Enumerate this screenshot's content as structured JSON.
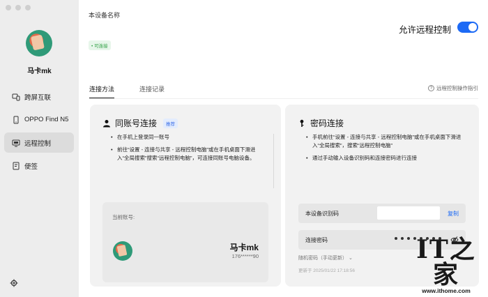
{
  "sidebar": {
    "username": "马卡mk",
    "items": [
      {
        "label": "跨屏互联",
        "icon": "cross-screen-icon",
        "active": false
      },
      {
        "label": "OPPO Find N5",
        "icon": "phone-icon",
        "active": false
      },
      {
        "label": "远程控制",
        "icon": "remote-control-icon",
        "active": true
      },
      {
        "label": "便签",
        "icon": "note-icon",
        "active": false
      }
    ],
    "settings_icon": "gear-icon"
  },
  "header": {
    "device_label": "本设备名称",
    "online_badge": "• 可连接",
    "allow_remote_label": "允许远程控制",
    "allow_remote_enabled": true
  },
  "tabs": {
    "items": [
      "连接方法",
      "连接记录"
    ],
    "active_index": 0,
    "guide_label": "远程控制操作指引"
  },
  "same_account": {
    "title": "同账号连接",
    "tag": "推荐",
    "bullets": [
      "在手机上登录同一账号",
      "前往“设置 - 连接与共享 - 远程控制电脑”或在手机桌面下滑进入“全局搜索”搜索“远程控制电脑”，可连接同账号电脑设备。"
    ],
    "current_account_label": "当前账号:",
    "account_name": "马卡mk",
    "account_phone": "176******90"
  },
  "password_connect": {
    "title": "密码连接",
    "bullets": [
      "手机前往“设置 - 连接与共享 - 远程控制电脑”或在手机桌面下滑进入“全局搜索”，搜索“远程控制电脑”",
      "通过手动输入设备识别码和连接密码进行连接"
    ],
    "device_code_label": "本设备识别码",
    "copy_label": "复制",
    "password_label": "连接密码",
    "random_password_label": "随机密码（手动更新） ⌄",
    "updated_at": "更新于 2025/01/22 17:18:56"
  },
  "watermark": {
    "logo": "IT之家",
    "url": "www.ithome.com"
  },
  "colors": {
    "accent": "#1d6af5",
    "online_green": "#2ea043",
    "sidebar_bg": "#ededed",
    "panel_bg": "#f2f2f2"
  }
}
